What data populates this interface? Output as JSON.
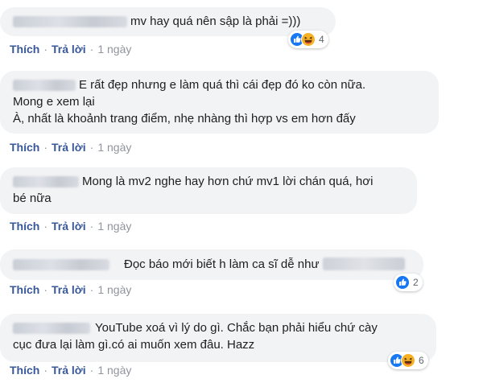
{
  "actions": {
    "like": "Thích",
    "reply": "Trả lời",
    "separator": "·"
  },
  "colors": {
    "link": "#385898",
    "meta": "#90949c",
    "bubble": "#f2f3f5",
    "like_blue": "#1877f2",
    "haha_yellow": "#f7b125"
  },
  "comments": [
    {
      "text_a": "mv hay quá nên sập là phải =)))",
      "time": "1 ngày",
      "reactions": [
        "like-icon",
        "haha-icon"
      ],
      "reaction_count": "4"
    },
    {
      "text_a": "E rất đẹp nhưng e làm quá thì cái đẹp đó ko còn nữa.",
      "text_b": "Mong e xem lại",
      "text_c": "À, nhất là khoảnh trang điểm, nhẹ nhàng thì hợp vs em hơn đấy",
      "time": "1 ngày"
    },
    {
      "text_a": "Mong là mv2 nghe hay hơn chứ mv1 lời chán quá, hơi",
      "text_b": "bé nữa",
      "time": "1 ngày"
    },
    {
      "text_a": "Đọc báo mới biết h làm ca sĩ dễ như",
      "time": "1 ngày",
      "reactions": [
        "like-icon"
      ],
      "reaction_count": "2"
    },
    {
      "text_a": "YouTube xoá vì lý do gì. Chắc bạn phải hiểu chứ cày",
      "text_b": "cục đưa lại làm gì.có ai muốn xem đâu. Hazz",
      "time": "1 ngày",
      "reactions": [
        "like-icon",
        "haha-icon"
      ],
      "reaction_count": "6"
    }
  ]
}
